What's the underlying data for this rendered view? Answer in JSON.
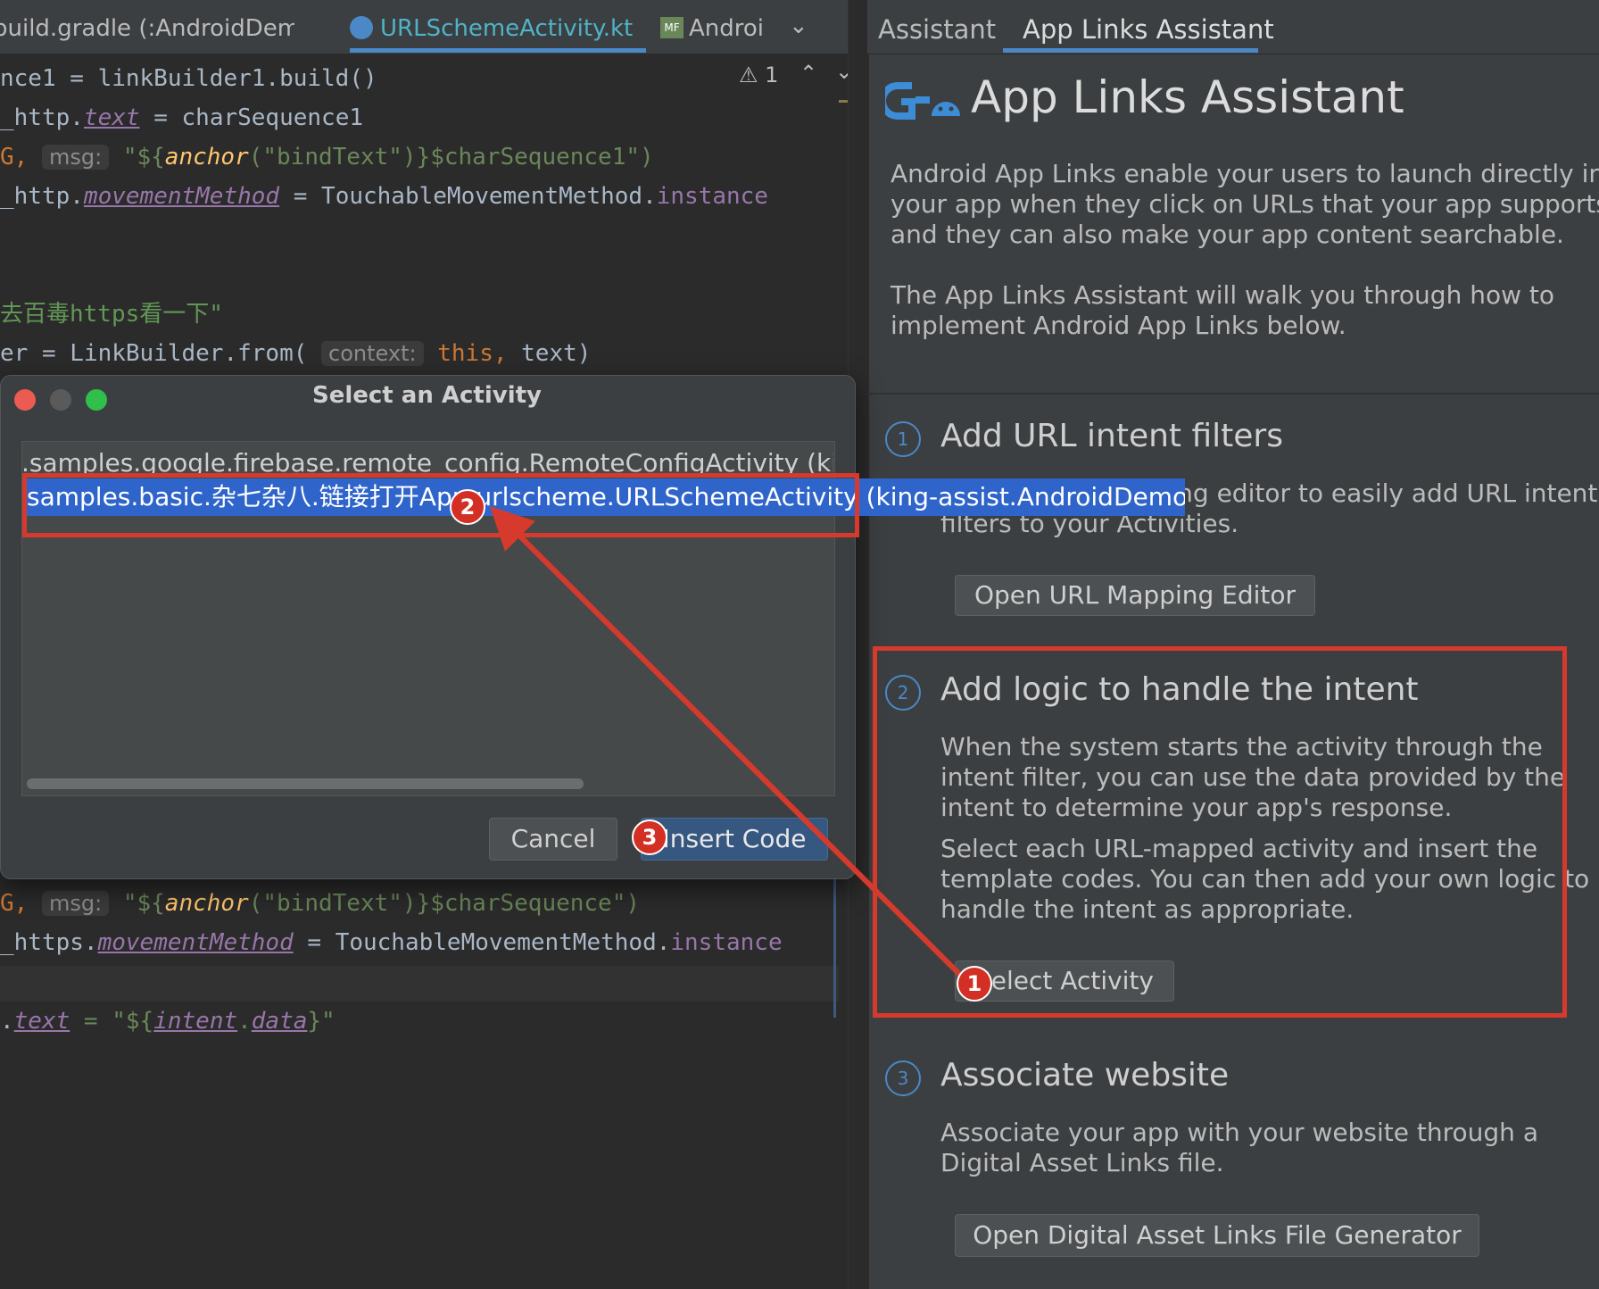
{
  "editor": {
    "tabs": [
      {
        "label": "build.gradle (:AndroidDemos)"
      },
      {
        "label": "URLSchemeActivity.kt"
      },
      {
        "label": "Androi"
      }
    ],
    "warning_count": "1",
    "lines": {
      "l1": "nce1 = linkBuilder1.build()",
      "l2a": "_http.",
      "l2b": "text",
      "l2c": " = charSequence1",
      "l3a": "G, ",
      "l3hint": "msg:",
      "l3b": "\"${",
      "l3fn": "anchor",
      "l3c": "(\"bindText\")}$charSequence1\")",
      "l4a": "_http.",
      "l4b": "movementMethod",
      "l4c": " = TouchableMovementMethod.",
      "l4d": "instance",
      "l5": "去百毒https看一下\"",
      "l6a": "er = LinkBuilder.from( ",
      "l6hint": "context:",
      "l6b": " this,",
      "l6c": " text)",
      "l7a": "G, ",
      "l7hint": "msg:",
      "l7b": "\"${",
      "l7fn": "anchor",
      "l7c": "(\"bindText\")}$charSequence\")",
      "l8a": "_https.",
      "l8b": "movementMethod",
      "l8c": " = TouchableMovementMethod.",
      "l8d": "instance",
      "l9a": ".",
      "l9b": "text",
      "l9c": " = \"${",
      "l9d": "intent",
      "l9e": ".",
      "l9f": "data",
      "l9g": "}\""
    }
  },
  "assistant": {
    "tabs": [
      {
        "label": "Assistant"
      },
      {
        "label": "App Links Assistant"
      }
    ],
    "title": "App Links Assistant",
    "intro1": "Android App Links enable your users to launch directly into your app when they click on URLs that your app supports and they can also make your app content searchable.",
    "intro2": "The App Links Assistant will walk you through how to implement Android App Links below.",
    "steps": [
      {
        "num": "1",
        "title": "Add URL intent filters",
        "desc": "Use the URL Mapping editor to easily add URL intent filters to your Activities.",
        "button": "Open URL Mapping Editor"
      },
      {
        "num": "2",
        "title": "Add logic to handle the intent",
        "desc": "When the system starts the activity through the intent filter, you can use the data provided by the intent to determine your app's response.",
        "desc2": "Select each URL-mapped activity and insert the template codes. You can then add your own logic to handle the intent as appropriate.",
        "button": "Select Activity"
      },
      {
        "num": "3",
        "title": "Associate website",
        "desc": "Associate your app with your website through a Digital Asset Links file.",
        "button": "Open Digital Asset Links File Generator"
      }
    ]
  },
  "dialog": {
    "title": "Select an Activity",
    "items": [
      ".samples.google.firebase.remote_config.RemoteConfigActivity (king-assist.AndroidDemos)",
      "samples.basic.杂七杂八.链接打开App.urlscheme.URLSchemeActivity (king-assist.AndroidDemos)"
    ],
    "cancel": "Cancel",
    "insert": "Insert Code"
  },
  "annotations": {
    "badges": [
      "1",
      "2",
      "3"
    ],
    "color": "#d63a2d"
  },
  "colors": {
    "editor_bg": "#2b2b2b",
    "panel_bg": "#3c3f41",
    "selection": "#2f65ca",
    "accent": "#4a88c7"
  }
}
